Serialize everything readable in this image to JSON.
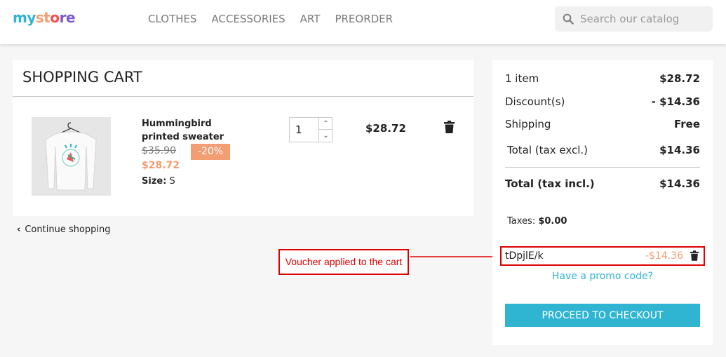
{
  "header": {
    "logo": {
      "part1": "my",
      "part2": "st",
      "part3": "o",
      "part4": "re"
    },
    "nav": [
      "CLOTHES",
      "ACCESSORIES",
      "ART",
      "PREORDER"
    ],
    "search_placeholder": "Search our catalog"
  },
  "cart": {
    "title": "SHOPPING CART",
    "product": {
      "name": "Hummingbird printed sweater",
      "old_price": "$35.90",
      "discount": "-20%",
      "new_price": "$28.72",
      "size_label": "Size:",
      "size_value": "S",
      "quantity": "1",
      "line_total": "$28.72"
    },
    "continue_label": "Continue shopping"
  },
  "annotation": {
    "text": "Voucher applied to the cart"
  },
  "summary": {
    "items_label": "1 item",
    "items_value": "$28.72",
    "discount_label": "Discount(s)",
    "discount_value": "- $14.36",
    "shipping_label": "Shipping",
    "shipping_value": "Free",
    "total_excl_label": "Total (tax excl.)",
    "total_excl_value": "$14.36",
    "total_incl_label": "Total (tax incl.)",
    "total_incl_value": "$14.36",
    "taxes_label": "Taxes:",
    "taxes_value": "$0.00",
    "voucher_code": "tDpjlE/k",
    "voucher_amount": "-$14.36",
    "promo_link": "Have a promo code?",
    "checkout_label": "PROCEED TO CHECKOUT"
  },
  "colors": {
    "accent": "#2fb5d2",
    "discount": "#f39d72",
    "annotation": "#dd0000"
  },
  "icons": [
    "search-icon",
    "trash-icon",
    "chevron-left-icon",
    "chevron-up-icon",
    "chevron-down-icon"
  ]
}
